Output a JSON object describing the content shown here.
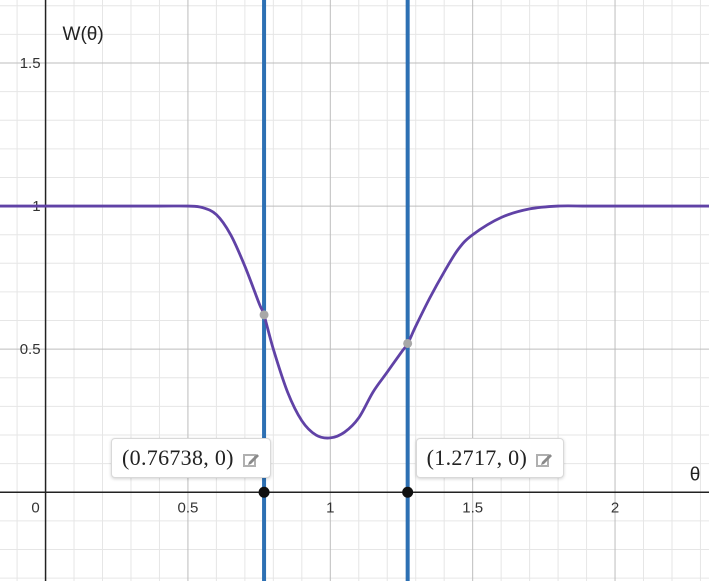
{
  "chart_data": {
    "type": "line",
    "xlabel": "θ",
    "ylabel": "W(θ)",
    "xlim": [
      -0.16,
      2.33
    ],
    "ylim": [
      -0.31,
      1.72
    ],
    "grid": true,
    "x_ticks": [
      0.5,
      1,
      1.5,
      2
    ],
    "x_tick_labels": [
      "0.5",
      "1",
      "1.5",
      "2"
    ],
    "y_ticks": [
      0.5,
      1,
      1.5
    ],
    "y_tick_labels": [
      "0.5",
      "1",
      "1.5"
    ],
    "origin_label": "0",
    "curve": {
      "color": "#6042a6",
      "x": [
        -0.16,
        0.0,
        0.2,
        0.4,
        0.5,
        0.55,
        0.6,
        0.65,
        0.7,
        0.75,
        0.767,
        0.8,
        0.85,
        0.9,
        0.95,
        1.0,
        1.05,
        1.1,
        1.15,
        1.2,
        1.25,
        1.272,
        1.3,
        1.35,
        1.4,
        1.45,
        1.5,
        1.6,
        1.7,
        1.8,
        1.9,
        2.0,
        2.33
      ],
      "y": [
        1.0,
        1.0,
        1.0,
        1.0,
        1.0,
        0.995,
        0.97,
        0.9,
        0.79,
        0.66,
        0.62,
        0.5,
        0.35,
        0.25,
        0.2,
        0.19,
        0.21,
        0.26,
        0.35,
        0.42,
        0.49,
        0.52,
        0.58,
        0.68,
        0.77,
        0.85,
        0.9,
        0.96,
        0.99,
        1.0,
        1.0,
        1.0,
        1.0
      ]
    },
    "vertical_lines": [
      {
        "x": 0.76738,
        "color": "#2d70b3"
      },
      {
        "x": 1.2717,
        "color": "#2d70b3"
      }
    ],
    "intersection_points": [
      {
        "x": 0.76738,
        "y": 0.62
      },
      {
        "x": 1.2717,
        "y": 0.52
      }
    ],
    "root_points": [
      {
        "x": 0.76738,
        "y": 0
      },
      {
        "x": 1.2717,
        "y": 0
      }
    ],
    "callouts": [
      {
        "label": "(0.76738, 0)"
      },
      {
        "label": "(1.2717, 0)"
      }
    ]
  }
}
